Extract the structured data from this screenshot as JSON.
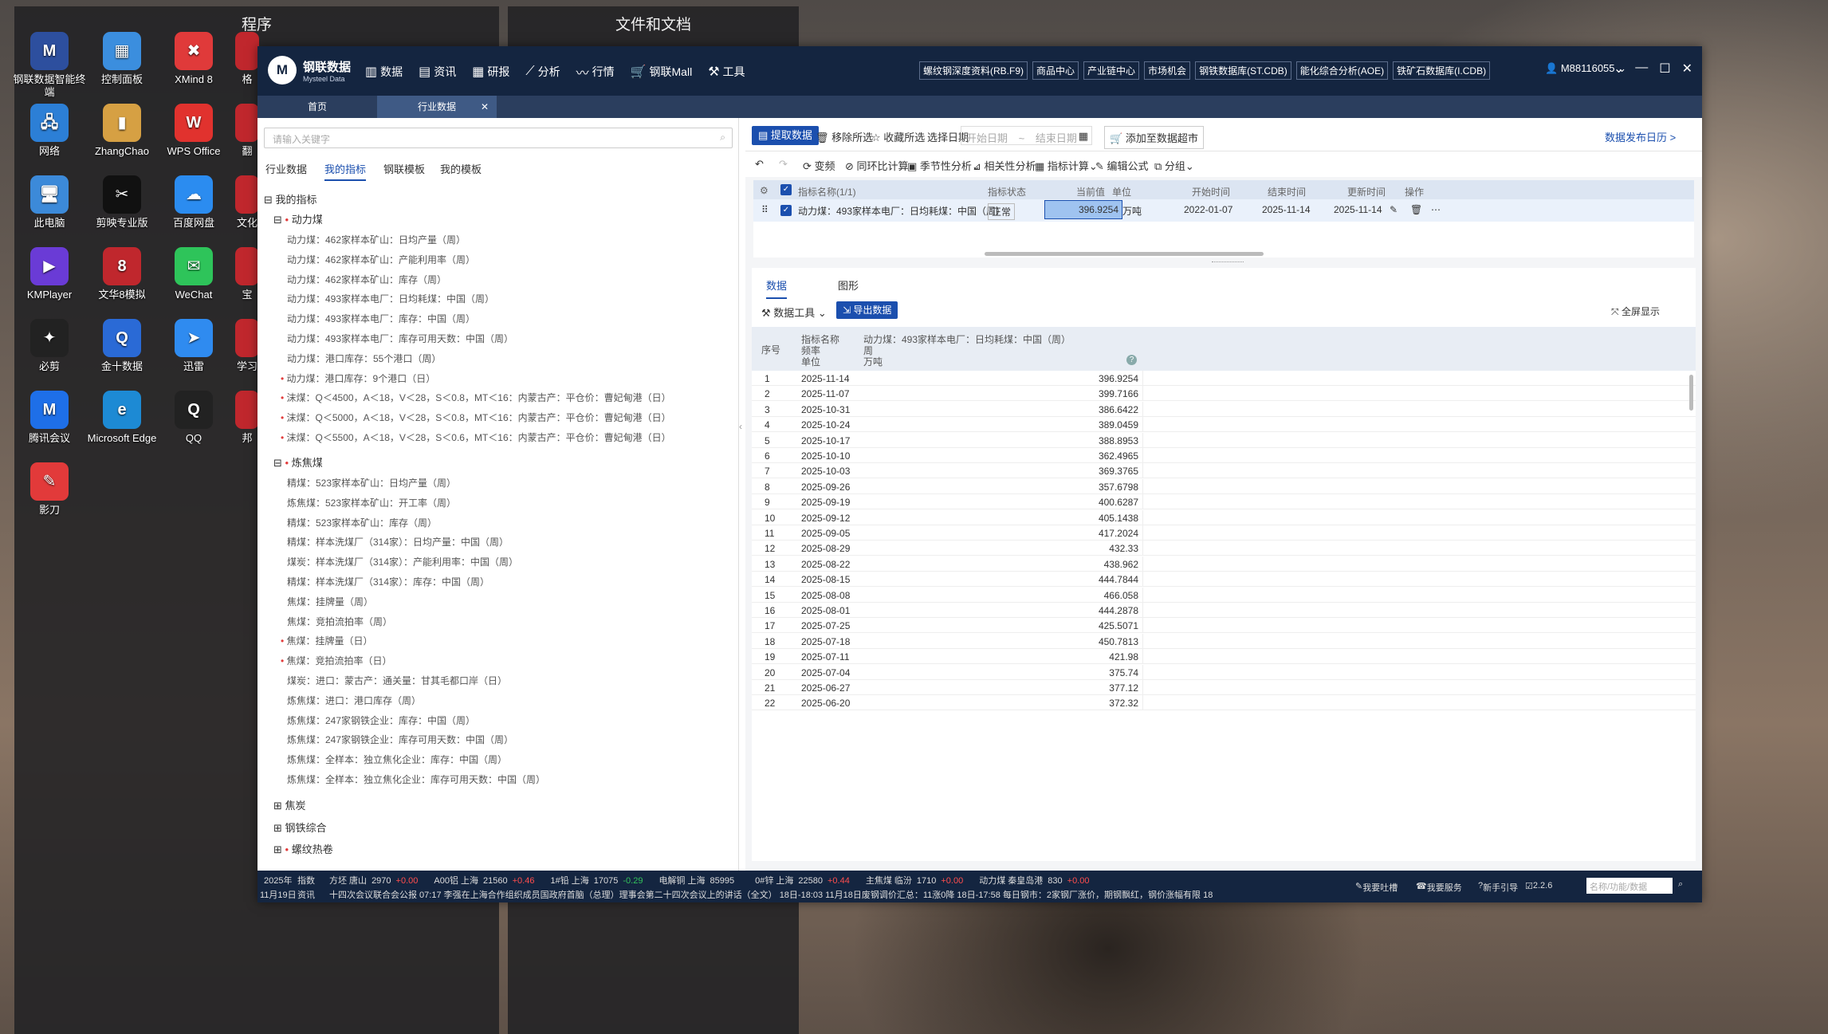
{
  "desktop": {
    "panel_programs": "程序",
    "panel_docs": "文件和文档",
    "icons": [
      {
        "label": "钢联数据智能终端",
        "color": "#2d4f9e",
        "glyph": "M"
      },
      {
        "label": "控制面板",
        "color": "#3b8ede",
        "glyph": "▦"
      },
      {
        "label": "XMind 8",
        "color": "#e03a3a",
        "glyph": "✖"
      },
      {
        "label": "网络",
        "color": "#2c7fd6",
        "glyph": "🖧"
      },
      {
        "label": "ZhangChao",
        "color": "#d6a043",
        "glyph": "▮"
      },
      {
        "label": "WPS Office",
        "color": "#e1322e",
        "glyph": "W"
      },
      {
        "label": "此电脑",
        "color": "#3c8ad9",
        "glyph": "🖥"
      },
      {
        "label": "剪映专业版",
        "color": "#111",
        "glyph": "✂"
      },
      {
        "label": "百度网盘",
        "color": "#2b8cf0",
        "glyph": "☁"
      },
      {
        "label": "KMPlayer",
        "color": "#6a3bd6",
        "glyph": "▶"
      },
      {
        "label": "文华8模拟",
        "color": "#c0272d",
        "glyph": "8"
      },
      {
        "label": "WeChat",
        "color": "#2ec45a",
        "glyph": "✉"
      },
      {
        "label": "必剪",
        "color": "#222",
        "glyph": "✦"
      },
      {
        "label": "金十数据",
        "color": "#2a6ad6",
        "glyph": "Q"
      },
      {
        "label": "迅雷",
        "color": "#2f8bf0",
        "glyph": "➤"
      },
      {
        "label": "腾讯会议",
        "color": "#1e6fe8",
        "glyph": "M"
      },
      {
        "label": "Microsoft Edge",
        "color": "#1d8ad4",
        "glyph": "e"
      },
      {
        "label": "QQ",
        "color": "#222",
        "glyph": "Q"
      },
      {
        "label": "影刀",
        "color": "#e23a3a",
        "glyph": "✎"
      }
    ],
    "partial_labels": [
      "格",
      "翻",
      "文化",
      "宝",
      "学习",
      "邦"
    ]
  },
  "app": {
    "logo_title": "钢联数据",
    "logo_sub": "Mysteel Data",
    "menu": [
      "数据",
      "资讯",
      "研报",
      "分析",
      "行情",
      "钢联Mall",
      "工具"
    ],
    "menu_icons": [
      "chart-bars-icon",
      "news-icon",
      "report-icon",
      "analysis-icon",
      "quote-icon",
      "cart-icon",
      "tools-icon"
    ],
    "quick_links": [
      "螺纹钢深度资料(RB.F9)",
      "商品中心",
      "产业链中心",
      "市场机会",
      "钢铁数据库(ST.CDB)",
      "能化综合分析(AOE)",
      "铁矿石数据库(I.CDB)"
    ],
    "user": "M88116055",
    "tabs": [
      "首页",
      "行业数据"
    ]
  },
  "left": {
    "search_placeholder": "请输入关键字",
    "tabs": [
      "行业数据",
      "我的指标",
      "钢联模板",
      "我的模板"
    ],
    "root": "我的指标",
    "cat1": "动力煤",
    "cat1_items": [
      {
        "t": "动力煤：462家样本矿山：日均产量（周）",
        "dot": false
      },
      {
        "t": "动力煤：462家样本矿山：产能利用率（周）",
        "dot": false
      },
      {
        "t": "动力煤：462家样本矿山：库存（周）",
        "dot": false
      },
      {
        "t": "动力煤：493家样本电厂：日均耗煤：中国（周）",
        "dot": false
      },
      {
        "t": "动力煤：493家样本电厂：库存：中国（周）",
        "dot": false
      },
      {
        "t": "动力煤：493家样本电厂：库存可用天数：中国（周）",
        "dot": false
      },
      {
        "t": "动力煤：港口库存：55个港口（周）",
        "dot": false
      },
      {
        "t": "动力煤：港口库存：9个港口（日）",
        "dot": true
      },
      {
        "t": "沫煤：Q＜4500，A＜18，V＜28，S＜0.8，MT＜16：内蒙古产：平仓价：曹妃甸港（日）",
        "dot": true
      },
      {
        "t": "沫煤：Q＜5000，A＜18，V＜28，S＜0.8，MT＜16：内蒙古产：平仓价：曹妃甸港（日）",
        "dot": true
      },
      {
        "t": "沫煤：Q＜5500，A＜18，V＜28，S＜0.6，MT＜16：内蒙古产：平仓价：曹妃甸港（日）",
        "dot": true
      }
    ],
    "cat2": "炼焦煤",
    "cat2_items": [
      {
        "t": "精煤：523家样本矿山：日均产量（周）",
        "dot": false
      },
      {
        "t": "炼焦煤：523家样本矿山：开工率（周）",
        "dot": false
      },
      {
        "t": "精煤：523家样本矿山：库存（周）",
        "dot": false
      },
      {
        "t": "精煤：样本洗煤厂（314家）：日均产量：中国（周）",
        "dot": false
      },
      {
        "t": "煤炭：样本洗煤厂（314家）：产能利用率：中国（周）",
        "dot": false
      },
      {
        "t": "精煤：样本洗煤厂（314家）：库存：中国（周）",
        "dot": false
      },
      {
        "t": "焦煤：挂牌量（周）",
        "dot": false
      },
      {
        "t": "焦煤：竞拍流拍率（周）",
        "dot": false
      },
      {
        "t": "焦煤：挂牌量（日）",
        "dot": true
      },
      {
        "t": "焦煤：竞拍流拍率（日）",
        "dot": true
      },
      {
        "t": "煤炭：进口：蒙古产：通关量：甘其毛都口岸（日）",
        "dot": false
      },
      {
        "t": "炼焦煤：进口：港口库存（周）",
        "dot": false
      },
      {
        "t": "炼焦煤：247家钢铁企业：库存：中国（周）",
        "dot": false
      },
      {
        "t": "炼焦煤：247家钢铁企业：库存可用天数：中国（周）",
        "dot": false
      },
      {
        "t": "炼焦煤：全样本：独立焦化企业：库存：中国（周）",
        "dot": false
      },
      {
        "t": "炼焦煤：全样本：独立焦化企业：库存可用天数：中国（周）",
        "dot": false
      }
    ],
    "collapsed": [
      "焦炭",
      "钢铁综合",
      "螺纹热卷"
    ]
  },
  "right": {
    "toolbar1": {
      "fetch": "提取数据",
      "remove": "移除所选",
      "collect": "收藏所选",
      "select_date": "选择日期",
      "start_ph": "开始日期",
      "sep": "~",
      "end_ph": "结束日期",
      "add": "添加至数据超市",
      "calendar": "数据发布日历 >"
    },
    "toolbar2": [
      "变频",
      "同环比计算",
      "季节性分析",
      "相关性分析",
      "指标计算",
      "编辑公式",
      "分组"
    ],
    "grid_head": [
      "指标名称(1/1)",
      "指标状态",
      "当前值",
      "单位",
      "开始时间",
      "结束时间",
      "更新时间",
      "操作"
    ],
    "grid_row": {
      "name": "动力煤：493家样本电厂：日均耗煤：中国（周）",
      "status": "正常",
      "value": "396.9254",
      "unit": "万吨",
      "start": "2022-01-07",
      "end": "2025-11-14",
      "update": "2025-11-14"
    },
    "data_tabs": [
      "数据",
      "图形"
    ],
    "data_tools": "数据工具",
    "export": "导出数据",
    "fullscreen": "全屏显示",
    "table_head": {
      "seq": "序号",
      "name_label": "指标名称",
      "freq_label": "频率",
      "unit_label": "单位",
      "name": "动力煤：493家样本电厂：日均耗煤：中国（周）",
      "freq": "周",
      "unit": "万吨"
    },
    "rows": [
      [
        "1",
        "2025-11-14",
        "396.9254"
      ],
      [
        "2",
        "2025-11-07",
        "399.7166"
      ],
      [
        "3",
        "2025-10-31",
        "386.6422"
      ],
      [
        "4",
        "2025-10-24",
        "389.0459"
      ],
      [
        "5",
        "2025-10-17",
        "388.8953"
      ],
      [
        "6",
        "2025-10-10",
        "362.4965"
      ],
      [
        "7",
        "2025-10-03",
        "369.3765"
      ],
      [
        "8",
        "2025-09-26",
        "357.6798"
      ],
      [
        "9",
        "2025-09-19",
        "400.6287"
      ],
      [
        "10",
        "2025-09-12",
        "405.1438"
      ],
      [
        "11",
        "2025-09-05",
        "417.2024"
      ],
      [
        "12",
        "2025-08-29",
        "432.33"
      ],
      [
        "13",
        "2025-08-22",
        "438.962"
      ],
      [
        "14",
        "2025-08-15",
        "444.7844"
      ],
      [
        "15",
        "2025-08-08",
        "466.058"
      ],
      [
        "16",
        "2025-08-01",
        "444.2878"
      ],
      [
        "17",
        "2025-07-25",
        "425.5071"
      ],
      [
        "18",
        "2025-07-18",
        "450.7813"
      ],
      [
        "19",
        "2025-07-11",
        "421.98"
      ],
      [
        "20",
        "2025-07-04",
        "375.74"
      ],
      [
        "21",
        "2025-06-27",
        "377.12"
      ],
      [
        "22",
        "2025-06-20",
        "372.32"
      ]
    ]
  },
  "statusbar": {
    "year": "2025年",
    "date": "11月19日",
    "idx_label": "指数",
    "news_label": "资讯",
    "tickers": [
      {
        "name": "方坯 唐山",
        "val": "2970",
        "chg": "+0.00",
        "c": "red"
      },
      {
        "name": "A00铝 上海",
        "val": "21560",
        "chg": "+0.46",
        "c": "red"
      },
      {
        "name": "1#铅 上海",
        "val": "17075",
        "chg": "-0.29",
        "c": "green"
      },
      {
        "name": "电解铜 上海",
        "val": "85995",
        "chg": "",
        "c": "red"
      },
      {
        "name": "0#锌 上海",
        "val": "22580",
        "chg": "+0.44",
        "c": "red"
      },
      {
        "name": "主焦煤 临汾",
        "val": "1710",
        "chg": "+0.00",
        "c": "red"
      },
      {
        "name": "动力煤 秦皇岛港",
        "val": "830",
        "chg": "+0.00",
        "c": "red"
      }
    ],
    "news": "十四次会议联合会公报    07:17 李强在上海合作组织成员国政府首脑（总理）理事会第二十四次会议上的讲话（全文）    18日-18:03 11月18日废钢调价汇总：11涨0降    18日-17:58 每日钢市：2家钢厂涨价，期钢飘红，钢价涨幅有限    18",
    "feedback": "我要吐槽",
    "service": "我要服务",
    "guide": "新手引导",
    "version": "2.2.6",
    "search_ph": "名称/功能/数据"
  }
}
